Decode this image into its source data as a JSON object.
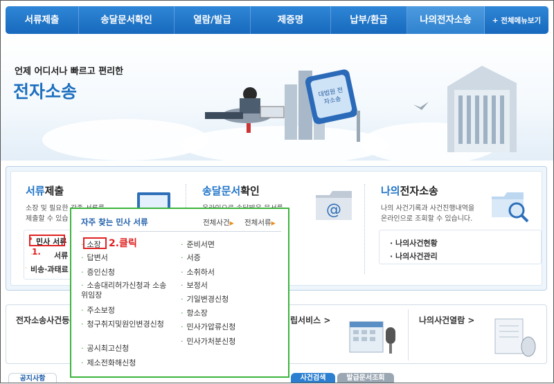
{
  "nav": {
    "items": [
      "서류제출",
      "송달문서확인",
      "열람/발급",
      "제증명",
      "납부/환급",
      "나의전자소송"
    ],
    "all_menu": "+ 전체메뉴보기"
  },
  "banner": {
    "tagline": "언제 어디서나 빠르고 편리한",
    "title": "전자소송",
    "monitor_text": "대법원 전자소송"
  },
  "main": {
    "col1": {
      "title_hl": "서류",
      "title_rest": "제출",
      "desc1": "소장 및 필요한 각종 서류를",
      "desc2": "제출할 수 있습",
      "links": [
        "민사 서류",
        "서류",
        "비송·과태료"
      ]
    },
    "col2": {
      "title_hl": "송달문서",
      "title_rest": "확인",
      "desc1": "온라인으로 송달받은 문서를",
      "desc2": ""
    },
    "col3": {
      "title_hl": "나의",
      "title_rest": "전자소송",
      "desc1": "나의 사건기록과 사건진행내역을",
      "desc2": "온라인으로 조회할 수 있습니다.",
      "links": [
        "나의사건현황",
        "나의사건관리"
      ]
    }
  },
  "lower": {
    "item1": "전자소송사건등록",
    "item2": "립서비스 >",
    "item3": "나의사건열람 >",
    "tabs": [
      "공지사항",
      "사건검색",
      "발급문서조회"
    ]
  },
  "popup": {
    "title": "자주 찾는 민사 서류",
    "link_all_cases": "전체사건",
    "link_all_docs": "전체서류",
    "left": [
      "소장",
      "답변서",
      "증인신청",
      "소송대리허가신청과 소송위임장",
      "주소보정",
      "청구취지및원인변경신청",
      "공시최고신청",
      "제소전화해신청"
    ],
    "right": [
      "준비서면",
      "서증",
      "소취하서",
      "보정서",
      "기일변경신청",
      "항소장",
      "민사가압류신청",
      "민사가처분신청"
    ]
  },
  "annotations": {
    "step1": "1.",
    "step2": "2.클릭"
  },
  "colors": {
    "nav_blue": "#1769bd",
    "accent_blue": "#1e73c8",
    "popup_border": "#3bb53b",
    "annotation_red": "#e02020"
  }
}
